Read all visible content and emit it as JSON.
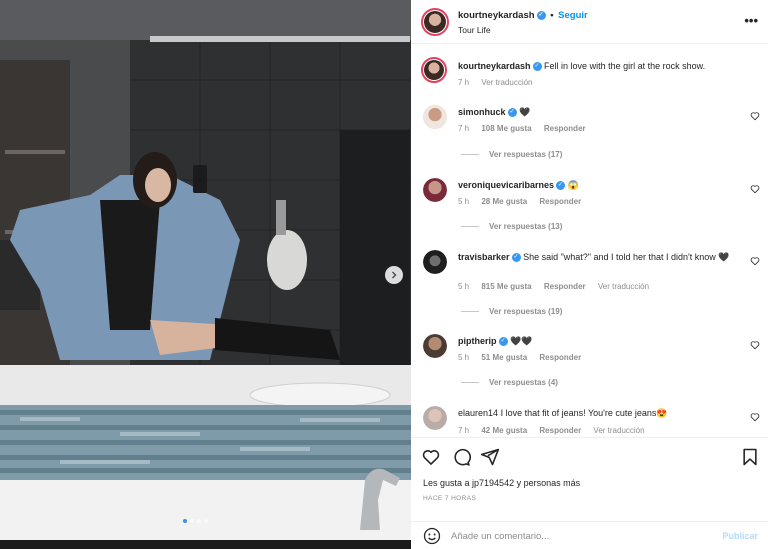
{
  "post": {
    "username": "kourtneykardash",
    "follow_label": "Seguir",
    "separator": "•",
    "location": "Tour Life",
    "more_label": "•••"
  },
  "caption": {
    "username": "kourtneykardash",
    "text": "Fell in love with the girl at the rock show.",
    "time": "7 h",
    "translate_label": "Ver traducción"
  },
  "comments": [
    {
      "username": "simonhuck",
      "text": "🖤",
      "time": "7 h",
      "likes": "108 Me gusta",
      "reply_label": "Responder",
      "translate_label": "",
      "replies": "Ver respuestas (17)"
    },
    {
      "username": "veroniquevicaribarnes",
      "text": "😱",
      "time": "5 h",
      "likes": "28 Me gusta",
      "reply_label": "Responder",
      "translate_label": "",
      "replies": "Ver respuestas (13)"
    },
    {
      "username": "travisbarker",
      "text": "She said \"what?\" and I told her that I didn't know 🖤",
      "time": "5 h",
      "likes": "815 Me gusta",
      "reply_label": "Responder",
      "translate_label": "Ver traducción",
      "replies": "Ver respuestas (19)"
    },
    {
      "username": "piptherip",
      "text": "🖤🖤",
      "time": "5 h",
      "likes": "51 Me gusta",
      "reply_label": "Responder",
      "translate_label": "",
      "replies": "Ver respuestas (4)"
    },
    {
      "username": "elauren14",
      "text": "I love that fit of jeans! You're cute jeans😍",
      "time": "7 h",
      "likes": "42 Me gusta",
      "reply_label": "Responder",
      "translate_label": "Ver traducción",
      "replies": ""
    }
  ],
  "footer": {
    "likes_text": "Les gusta a jp7194542 y personas más",
    "timestamp": "HACE 7 HORAS",
    "comment_placeholder": "Añade un comentario...",
    "publish_label": "Publicar"
  },
  "icons": {
    "heart": "heart-icon",
    "comment": "comment-icon",
    "share": "share-icon",
    "save": "bookmark-icon",
    "emoji": "emoji-icon",
    "next": "chevron-right-icon",
    "verified": "verified-icon"
  },
  "colors": {
    "link": "#0095f6",
    "verified": "#3897f0",
    "publish_disabled": "#b3dbff",
    "muted": "#8e8e8e"
  },
  "carousel": {
    "active_index": 1,
    "total": 4
  }
}
